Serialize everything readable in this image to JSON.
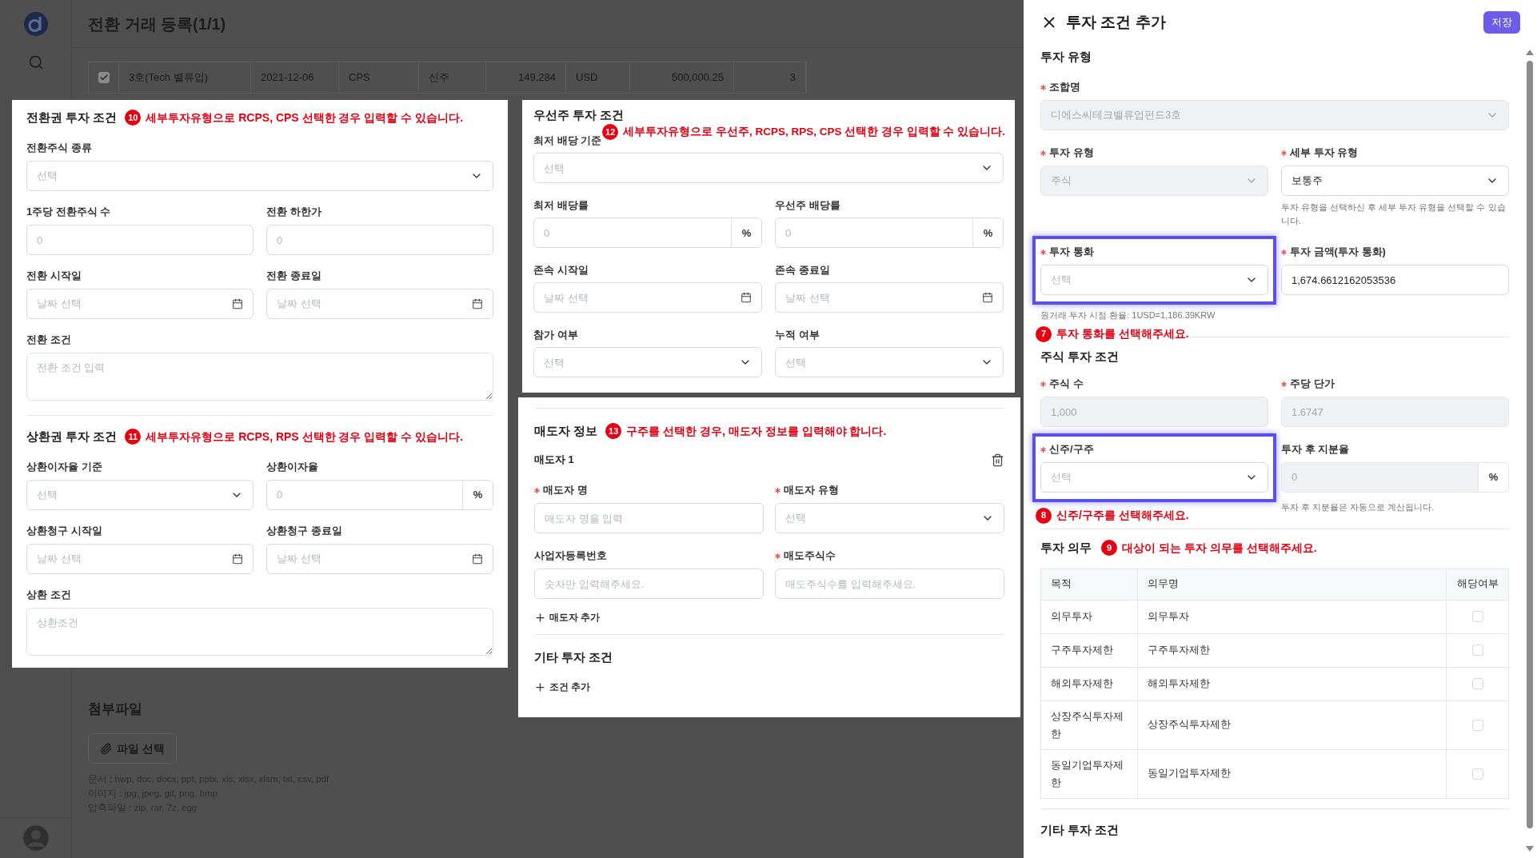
{
  "app": {
    "title": "전환 거래 등록(1/1)",
    "table_row": {
      "checked": true,
      "cells": [
        "3호(Tech 밸류업)",
        "2021-12-06",
        "CPS",
        "신주",
        "149,284",
        "USD",
        "500,000.25",
        "3"
      ]
    },
    "attachments": {
      "title": "첨부파일",
      "button": "파일 선택",
      "notes": [
        "문서 : hwp, doc, docx, ppt, pptx, xls, xlsx, xlsm, txt, csv, pdf",
        "이미지 : jpg, jpeg, gif, png, bmp",
        "압축파일 : zip, rar, 7z, egg"
      ]
    }
  },
  "conversion_panel": {
    "sections": [
      {
        "title": "전환권 투자 조건",
        "callout": {
          "number": "10",
          "text": "세부투자유형으로 RCPS, CPS 선택한 경우 입력할 수 있습니다."
        },
        "rows": [
          [
            {
              "label": "전환주식 종류",
              "kind": "select",
              "placeholder": "선택"
            }
          ],
          [
            {
              "label": "1주당 전환주식 수",
              "kind": "input",
              "placeholder": "0"
            },
            {
              "label": "전환 하한가",
              "kind": "input",
              "placeholder": "0"
            }
          ],
          [
            {
              "label": "전환 시작일",
              "kind": "date",
              "placeholder": "날짜 선택"
            },
            {
              "label": "전환 종료일",
              "kind": "date",
              "placeholder": "날짜 선택"
            }
          ],
          [
            {
              "label": "전환 조건",
              "kind": "textarea",
              "placeholder": "전환 조건 입력"
            }
          ]
        ]
      },
      {
        "title": "상환권 투자 조건",
        "callout": {
          "number": "11",
          "text": "세부투자유형으로 RCPS, RPS 선택한 경우 입력할 수 있습니다."
        },
        "rows": [
          [
            {
              "label": "상환이자율 기준",
              "kind": "select",
              "placeholder": "선택"
            },
            {
              "label": "상환이자율",
              "kind": "input",
              "placeholder": "0",
              "suffix": "%"
            }
          ],
          [
            {
              "label": "상환청구 시작일",
              "kind": "date",
              "placeholder": "날짜 선택"
            },
            {
              "label": "상환청구 종료일",
              "kind": "date",
              "placeholder": "날짜 선택"
            }
          ],
          [
            {
              "label": "상환 조건",
              "kind": "textarea",
              "placeholder": "상환조건"
            }
          ]
        ]
      }
    ]
  },
  "preferred_panel": {
    "title": "우선주 투자 조건",
    "callout": {
      "number": "12",
      "text": "세부투자유형으로 우선주, RCPS, RPS, CPS 선택한 경우 입력할 수 있습니다."
    },
    "rows": [
      [
        {
          "label": "최저 배당 기준",
          "kind": "select",
          "placeholder": "선택"
        }
      ],
      [
        {
          "label": "최저 배당률",
          "kind": "input",
          "placeholder": "0",
          "suffix": "%"
        },
        {
          "label": "우선주 배당률",
          "kind": "input",
          "placeholder": "0",
          "suffix": "%"
        }
      ],
      [
        {
          "label": "존속 시작일",
          "kind": "date",
          "placeholder": "날짜 선택"
        },
        {
          "label": "존속 종료일",
          "kind": "date",
          "placeholder": "날짜 선택"
        }
      ],
      [
        {
          "label": "참가 여부",
          "kind": "select",
          "placeholder": "선택"
        },
        {
          "label": "누적 여부",
          "kind": "select",
          "placeholder": "선택"
        }
      ]
    ]
  },
  "seller_panel": {
    "title": "매도자 정보",
    "callout": {
      "number": "13",
      "text": "구주를 선택한 경우, 매도자 정보를 입력해야 합니다."
    },
    "sellers": [
      {
        "title": "매도자 1",
        "rows": [
          [
            {
              "label": "매도자 명",
              "kind": "input",
              "placeholder": "매도자 명을 입력",
              "required": true
            },
            {
              "label": "매도자 유형",
              "kind": "select",
              "placeholder": "선택",
              "required": true
            }
          ],
          [
            {
              "label": "사업자등록번호",
              "kind": "input",
              "placeholder": "숫자만 입력해주세요.",
              "required": false
            },
            {
              "label": "매도주식수",
              "kind": "input",
              "placeholder": "매도주식수를 입력해주세요.",
              "required": true
            }
          ]
        ]
      }
    ],
    "add_seller": "매도자 추가",
    "other_title": "기타 투자 조건",
    "add_condition": "조건 추가"
  },
  "drawer": {
    "title": "투자 조건 추가",
    "save_button": "저장",
    "type_section": {
      "title": "투자 유형",
      "fund": {
        "label": "조합명",
        "kind": "select",
        "value": "디에스씨테크밸류업펀드3호",
        "required": true,
        "disabled": true,
        "highlighted": false
      },
      "type_row": [
        {
          "label": "투자 유형",
          "kind": "select",
          "value": "주식",
          "required": true,
          "disabled": true,
          "highlighted": false
        },
        {
          "label": "세부 투자 유형",
          "kind": "select",
          "value": "보통주",
          "required": true,
          "disabled": false,
          "highlighted": false
        }
      ],
      "subtype_help": "투자 유형을 선택하신 후 세부 투자 유형을 선택할 수 있습니다.",
      "currency_row": [
        {
          "label": "투자 통화",
          "kind": "select",
          "placeholder": "선택",
          "required": true,
          "disabled": false,
          "highlighted": true
        },
        {
          "label": "투자 금액(투자 통화)",
          "kind": "input",
          "value": "1,674.6612162053536",
          "required": true,
          "disabled": false,
          "highlighted": false
        }
      ],
      "rate_note": "원거래 투자 시점 환율: 1USD=1,186.39KRW",
      "callout": {
        "number": "7",
        "text": "투자 통화를 선택해주세요."
      }
    },
    "stock_section": {
      "title": "주식 투자 조건",
      "rows": [
        [
          {
            "label": "주식 수",
            "kind": "input",
            "value": "1,000",
            "required": true,
            "disabled": true,
            "highlighted": false
          },
          {
            "label": "주당 단가",
            "kind": "input",
            "value": "1.6747",
            "required": true,
            "disabled": true,
            "highlighted": false
          }
        ],
        [
          {
            "label": "신주/구주",
            "kind": "select",
            "placeholder": "선택",
            "required": true,
            "disabled": false,
            "highlighted": true
          },
          {
            "label": "투자 후 지분율",
            "kind": "input",
            "value": "0",
            "suffix": "%",
            "required": false,
            "disabled": true,
            "highlighted": false
          }
        ]
      ],
      "share_help": "투자 후 지분율은 자동으로 계산됩니다.",
      "callout": {
        "number": "8",
        "text": "신주/구주를 선택해주세요."
      }
    },
    "duty_section": {
      "title": "투자 의무",
      "callout": {
        "number": "9",
        "text": "대상이 되는 투자 의무를 선택해주세요."
      },
      "columns": [
        "목적",
        "의무명",
        "해당여부"
      ],
      "rows": [
        {
          "purpose": "의무투자",
          "name": "의무투자",
          "checked": false
        },
        {
          "purpose": "구주투자제한",
          "name": "구주투자제한",
          "checked": false
        },
        {
          "purpose": "해외투자제한",
          "name": "해외투자제한",
          "checked": false
        },
        {
          "purpose": "상장주식투자제한",
          "name": "상장주식투자제한",
          "checked": false
        },
        {
          "purpose": "동일기업투자제한",
          "name": "동일기업투자제한",
          "checked": false
        }
      ]
    },
    "other_title": "기타 투자 조건"
  }
}
